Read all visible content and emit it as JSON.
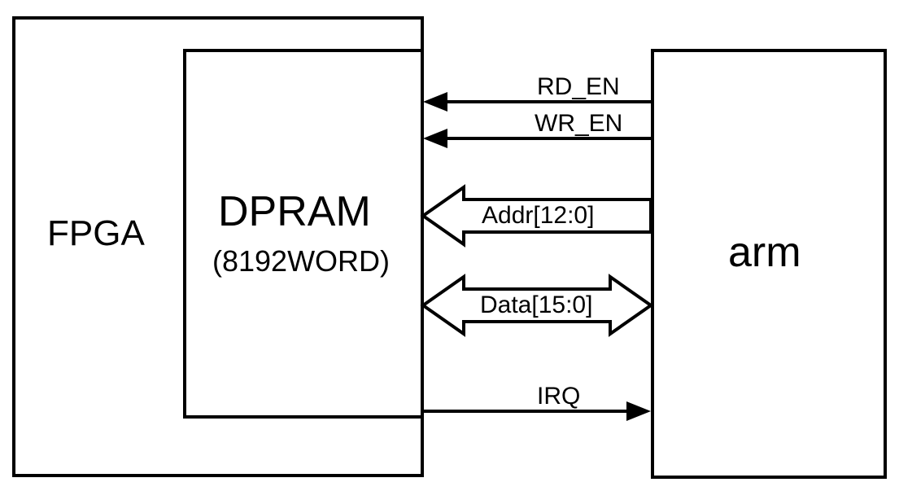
{
  "blocks": {
    "fpga": "FPGA",
    "dpram_title": "DPRAM",
    "dpram_sub": "(8192WORD)",
    "arm": "arm"
  },
  "signals": {
    "rd_en": "RD_EN",
    "wr_en": "WR_EN",
    "addr": "Addr[12:0]",
    "data": "Data[15:0]",
    "irq": "IRQ"
  }
}
